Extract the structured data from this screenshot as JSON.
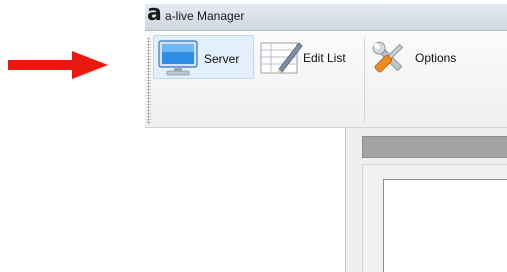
{
  "window": {
    "logo_letter": "a",
    "title": "a-live Manager"
  },
  "toolbar": {
    "buttons": [
      {
        "label": "Server",
        "icon": "monitor-icon",
        "state": "active"
      },
      {
        "label": "Edit List",
        "icon": "edit-list-icon",
        "state": "normal"
      },
      {
        "label": "Options",
        "icon": "tools-icon",
        "state": "normal"
      }
    ]
  },
  "annotation": {
    "arrow_color": "#e8190f"
  },
  "colors": {
    "titlebar": "#d7dee8",
    "active_button": "#e3f0fb",
    "panel_header": "#a3a3a3"
  }
}
